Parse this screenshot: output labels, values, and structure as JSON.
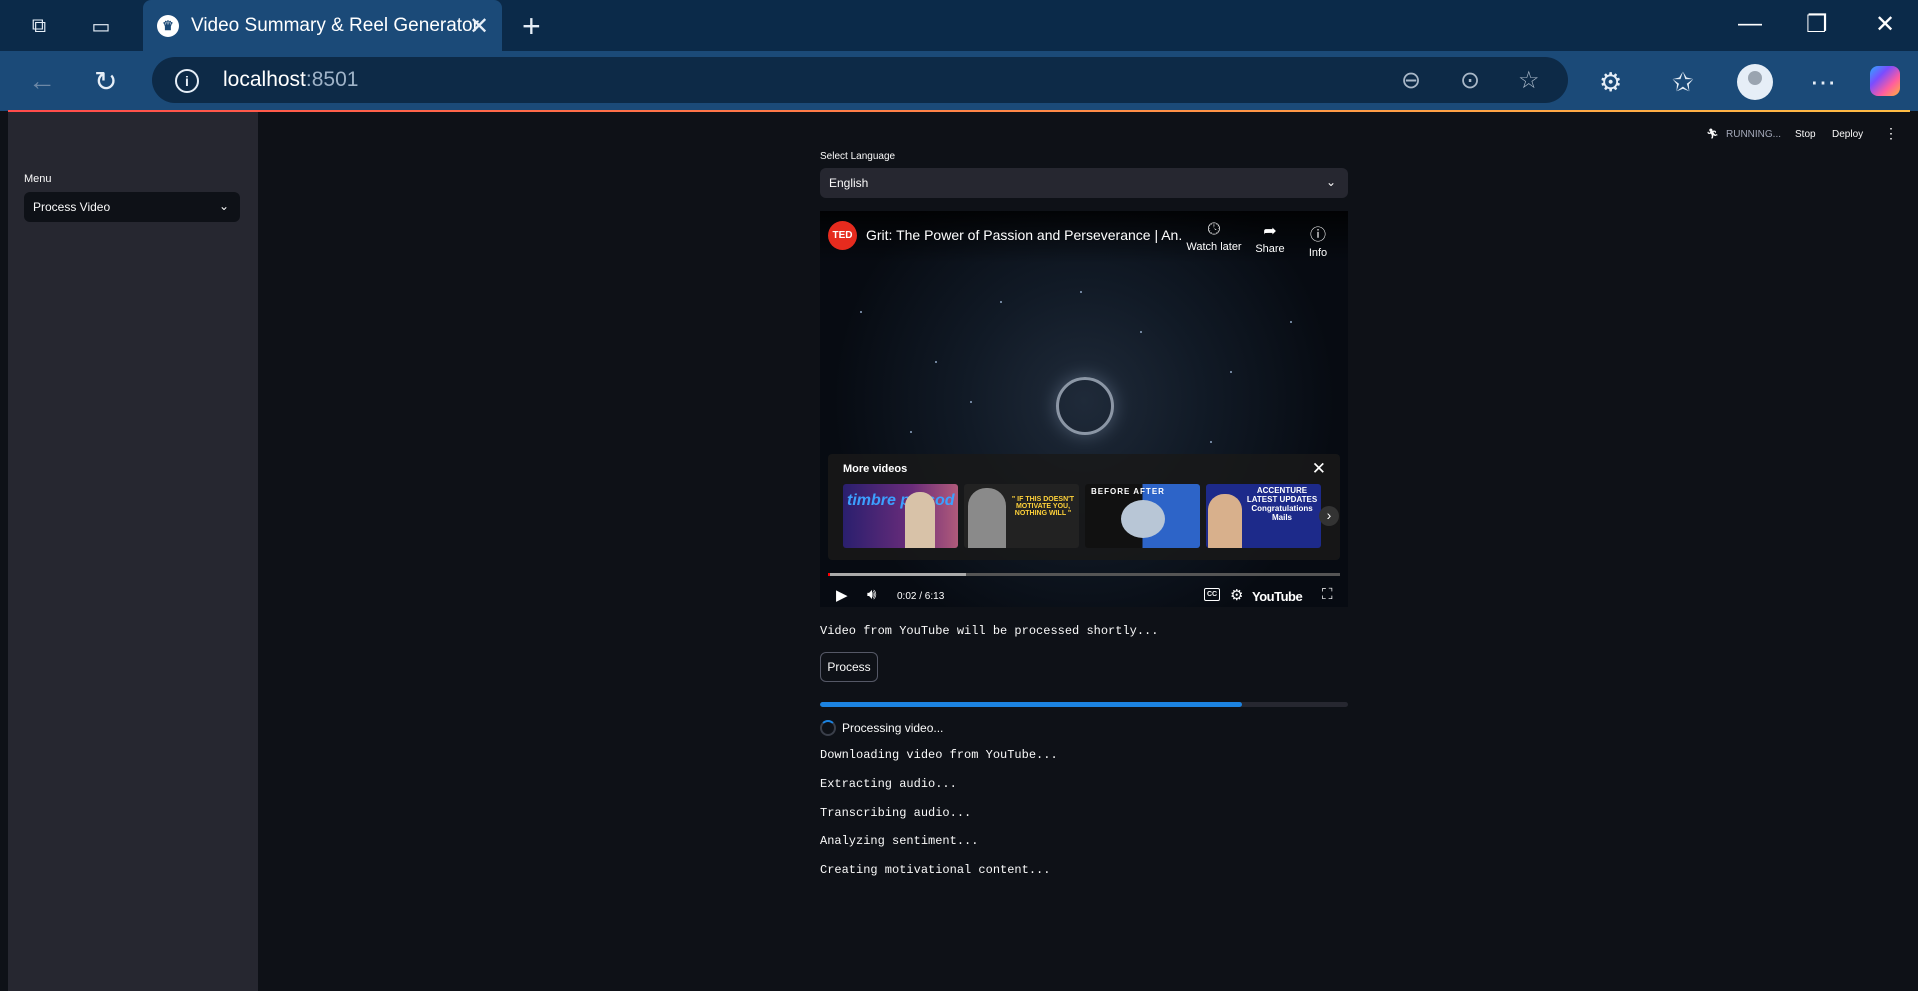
{
  "browser": {
    "tab_title": "Video Summary & Reel Generator",
    "url_host": "localhost",
    "url_port": ":8501"
  },
  "app_header": {
    "status": "RUNNING...",
    "stop_label": "Stop",
    "deploy_label": "Deploy"
  },
  "sidebar": {
    "menu_label": "Menu",
    "menu_value": "Process Video"
  },
  "main": {
    "language_label": "Select Language",
    "language_value": "English",
    "video": {
      "channel_badge": "TED",
      "title": "Grit: The Power of Passion and Perseverance | An...",
      "actions": [
        "Watch later",
        "Share",
        "Info"
      ],
      "more_videos_label": "More videos",
      "thumbnails": [
        {
          "text": "timbre prosod"
        },
        {
          "text": "\" IF THIS DOESN'T MOTIVATE YOU, NOTHING WILL \""
        },
        {
          "text": "BEFORE  AFTER"
        },
        {
          "text": "ACCENTURE LATEST UPDATES Congratulations Mails"
        }
      ],
      "time": "0:02 / 6:13",
      "buffered_fraction": 0.27,
      "played_fraction": 0.004,
      "cc_label": "CC",
      "brand": "YouTube"
    },
    "info_message": "Video from YouTube will be processed shortly...",
    "process_button": "Process",
    "progress_fraction": 0.8,
    "spinner_text": "Processing video...",
    "log_lines": [
      "Downloading video from YouTube...",
      "Extracting audio...",
      "Transcribing audio...",
      "Analyzing sentiment...",
      "Creating motivational content..."
    ]
  }
}
